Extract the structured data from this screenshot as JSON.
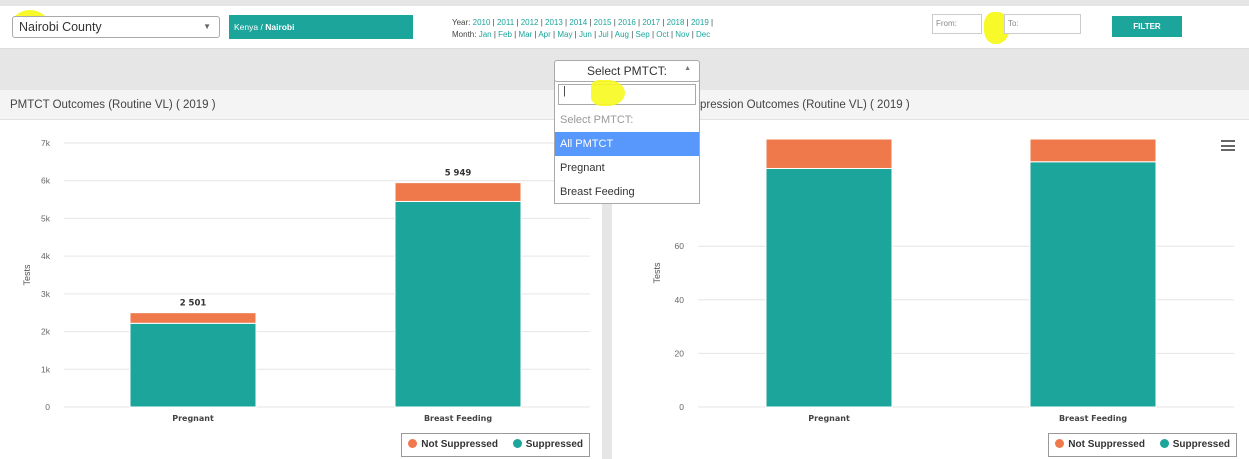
{
  "header": {
    "county_select": "Nairobi County",
    "breadcrumb": {
      "country": "Kenya",
      "separator": " / ",
      "county": "Nairobi"
    },
    "years_label": "Year:",
    "years": [
      "2010",
      "2011",
      "2012",
      "2013",
      "2014",
      "2015",
      "2016",
      "2017",
      "2018",
      "2019"
    ],
    "months_label": "Month:",
    "months": [
      "Jan",
      "Feb",
      "Mar",
      "Apr",
      "May",
      "Jun",
      "Jul",
      "Aug",
      "Sep",
      "Oct",
      "Nov",
      "Dec"
    ],
    "from_placeholder": "From:",
    "to_placeholder": "To:",
    "filter_button": "FILTER"
  },
  "pmtct_select": {
    "label": "Select PMTCT:",
    "search_value": "",
    "options": [
      {
        "label": "Select PMTCT:",
        "state": "disabled"
      },
      {
        "label": "All PMTCT",
        "state": "active"
      },
      {
        "label": "Pregnant",
        "state": "normal"
      },
      {
        "label": "Breast Feeding",
        "state": "normal"
      }
    ]
  },
  "panels": {
    "left_title": "PMTCT Outcomes (Routine VL) ( 2019 )",
    "right_title_visible": "pression Outcomes (Routine VL) ( 2019 )"
  },
  "legend": {
    "not_suppressed": "Not Suppressed",
    "suppressed": "Suppressed"
  },
  "colors": {
    "suppressed": "#1ca59b",
    "not_suppressed": "#f0794b",
    "accent": "#1ca59b",
    "highlight": "#f7f91e",
    "dropdown_active": "#5897fb"
  },
  "chart_data": [
    {
      "type": "bar",
      "stacked": true,
      "categories": [
        "Pregnant",
        "Breast Feeding"
      ],
      "series": [
        {
          "name": "Suppressed",
          "values": [
            2220,
            5450
          ]
        },
        {
          "name": "Not Suppressed",
          "values": [
            281,
            499
          ]
        }
      ],
      "data_labels": [
        "2 501",
        "5 949"
      ],
      "ylabel": "Tests",
      "ylim": [
        0,
        7000
      ],
      "yticks": [
        "0",
        "1k",
        "2k",
        "3k",
        "4k",
        "5k",
        "6k",
        "7k"
      ],
      "ytick_values": [
        0,
        1000,
        2000,
        3000,
        4000,
        5000,
        6000,
        7000
      ],
      "legend": "bottom-right",
      "grid": true
    },
    {
      "type": "bar",
      "stacked": true,
      "percent": true,
      "categories": [
        "Pregnant",
        "Breast Feeding"
      ],
      "series": [
        {
          "name": "Suppressed",
          "values": [
            89,
            91.5
          ]
        },
        {
          "name": "Not Suppressed",
          "values": [
            11,
            8.5
          ]
        }
      ],
      "ylabel": "Tests",
      "ylim": [
        0,
        100
      ],
      "yticks": [
        "0",
        "20",
        "40",
        "60"
      ],
      "ytick_values": [
        0,
        20,
        40,
        60
      ],
      "legend": "bottom-right",
      "grid": true
    }
  ]
}
